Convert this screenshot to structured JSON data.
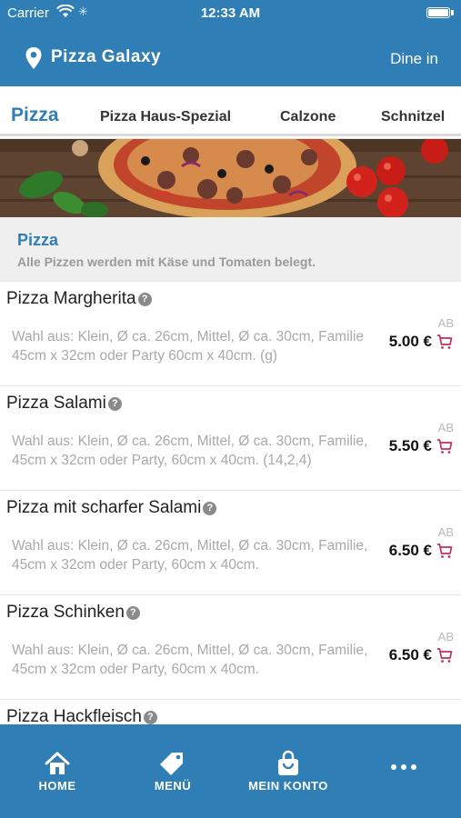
{
  "status_bar": {
    "carrier": "Carrier",
    "time": "12:33 AM"
  },
  "header": {
    "title": "Pizza Galaxy",
    "mode": "Dine in"
  },
  "tabs": [
    {
      "label": "Pizza",
      "active": true
    },
    {
      "label": "Pizza Haus-Spezial",
      "active": false
    },
    {
      "label": "Calzone",
      "active": false
    },
    {
      "label": "Schnitzel",
      "active": false
    }
  ],
  "category": {
    "name": "Pizza",
    "description": "Alle Pizzen werden mit Käse und Tomaten belegt."
  },
  "items": [
    {
      "name": "Pizza Margherita",
      "description": "Wahl aus: Klein, Ø ca. 26cm, Mittel, Ø ca. 30cm, Familie 45cm x 32cm oder Party 60cm x 40cm. (g)",
      "prefix": "AB",
      "price": "5.00 €"
    },
    {
      "name": "Pizza Salami",
      "description": "Wahl aus: Klein, Ø ca. 26cm, Mittel, Ø ca. 30cm, Familie, 45cm x 32cm oder Party, 60cm x 40cm. (14,2,4)",
      "prefix": "AB",
      "price": "5.50 €"
    },
    {
      "name": "Pizza mit scharfer Salami",
      "description": "Wahl aus: Klein, Ø ca. 26cm, Mittel, Ø ca. 30cm, Familie, 45cm x 32cm oder Party, 60cm x 40cm.",
      "prefix": "AB",
      "price": "6.50 €"
    },
    {
      "name": "Pizza Schinken",
      "description": "Wahl aus: Klein, Ø ca. 26cm, Mittel, Ø ca. 30cm, Familie, 45cm x 32cm oder Party, 60cm x 40cm.",
      "prefix": "AB",
      "price": "6.50 €"
    },
    {
      "name": "Pizza Hackfleisch",
      "description": "",
      "prefix": "",
      "price": ""
    }
  ],
  "bottom_nav": [
    {
      "label": "HOME",
      "icon": "home-icon"
    },
    {
      "label": "MENÜ",
      "icon": "tag-icon"
    },
    {
      "label": "MEIN KONTO",
      "icon": "shopping-bag-icon"
    },
    {
      "label": "",
      "icon": "more-dots-icon"
    }
  ],
  "colors": {
    "primary": "#2f7fb6",
    "cart": "#c0305a",
    "background": "#ffffff",
    "category_bg": "#efefef"
  }
}
